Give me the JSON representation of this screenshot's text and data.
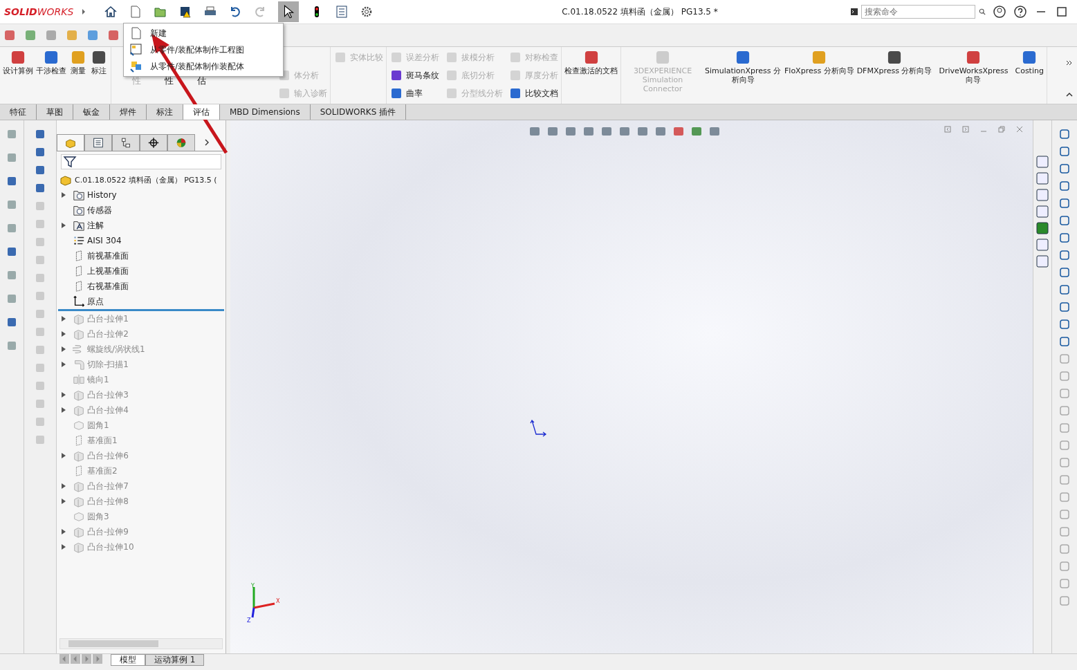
{
  "titlebar": {
    "logo": "**SOLID**WORKS",
    "title": "C.01.18.0522 填料函（金属） PG13.5 *",
    "search": {
      "placeholder": "搜索命令"
    }
  },
  "new_menu": {
    "items": [
      {
        "label": "新建",
        "kind": "new"
      },
      {
        "label": "从零件/装配体制作工程图",
        "kind": "drawing"
      },
      {
        "label": "从零件/装配体制作装配体",
        "kind": "assembly"
      }
    ]
  },
  "ribbon": {
    "groups": [
      {
        "kind": "large",
        "items": [
          {
            "label": "设计算例",
            "disabled": false
          },
          {
            "label": "干涉检查",
            "disabled": false
          },
          {
            "label": "测量",
            "disabled": false
          },
          {
            "label": "标注",
            "disabled": false
          }
        ]
      },
      {
        "kind": "fragment",
        "items": [
          {
            "label": "性",
            "disabled": true
          },
          {
            "label": "性",
            "disabled": false
          },
          {
            "label": "估",
            "disabled": false
          }
        ]
      },
      {
        "kind": "small",
        "items": [
          {
            "label": "体分析",
            "disabled": true
          },
          {
            "label": "输入诊断",
            "disabled": true
          }
        ]
      },
      {
        "kind": "small",
        "items": [
          {
            "label": "实体比较",
            "disabled": true
          }
        ]
      },
      {
        "kind": "small",
        "items": [
          {
            "label": "误差分析",
            "disabled": true
          },
          {
            "label": "斑马条纹",
            "disabled": false
          },
          {
            "label": "曲率",
            "disabled": false
          },
          {
            "label": "拔模分析",
            "disabled": true
          },
          {
            "label": "底切分析",
            "disabled": true
          },
          {
            "label": "分型线分析",
            "disabled": true
          },
          {
            "label": "对称检查",
            "disabled": true
          },
          {
            "label": "厚度分析",
            "disabled": true
          },
          {
            "label": "比较文档",
            "disabled": false
          }
        ]
      },
      {
        "kind": "large",
        "items": [
          {
            "label": "检查激活的文档",
            "disabled": false
          }
        ]
      },
      {
        "kind": "large",
        "items": [
          {
            "label": "3DEXPERIENCE Simulation Connector",
            "disabled": true
          },
          {
            "label": "SimulationXpress 分析向导",
            "disabled": false
          },
          {
            "label": "FloXpress 分析向导",
            "disabled": false
          },
          {
            "label": "DFMXpress 分析向导",
            "disabled": false
          },
          {
            "label": "DriveWorksXpress 向导",
            "disabled": false
          },
          {
            "label": "Costing",
            "disabled": false
          }
        ]
      }
    ]
  },
  "command_tabs": [
    {
      "label": "特征",
      "selected": false
    },
    {
      "label": "草图",
      "selected": false
    },
    {
      "label": "钣金",
      "selected": false
    },
    {
      "label": "焊件",
      "selected": false
    },
    {
      "label": "标注",
      "selected": false
    },
    {
      "label": "评估",
      "selected": true
    },
    {
      "label": "MBD Dimensions",
      "selected": false
    },
    {
      "label": "SOLIDWORKS 插件",
      "selected": false
    }
  ],
  "tree": {
    "root": "C.01.18.0522 填料函（金属） PG13.5 (",
    "items": [
      {
        "label": "History",
        "kind": "history",
        "expandable": true,
        "dimmed": false
      },
      {
        "label": "传感器",
        "kind": "sensor",
        "expandable": false,
        "dimmed": false
      },
      {
        "label": "注解",
        "kind": "annotation",
        "expandable": true,
        "dimmed": false
      },
      {
        "label": "AISI 304",
        "kind": "material",
        "expandable": false,
        "dimmed": false
      },
      {
        "label": "前视基准面",
        "kind": "plane",
        "expandable": false,
        "dimmed": false
      },
      {
        "label": "上视基准面",
        "kind": "plane",
        "expandable": false,
        "dimmed": false
      },
      {
        "label": "右视基准面",
        "kind": "plane",
        "expandable": false,
        "dimmed": false
      },
      {
        "label": "原点",
        "kind": "origin",
        "expandable": false,
        "dimmed": false
      },
      {
        "kind": "rollback"
      },
      {
        "label": "凸台-拉伸1",
        "kind": "extrude",
        "expandable": true,
        "dimmed": true
      },
      {
        "label": "凸台-拉伸2",
        "kind": "extrude",
        "expandable": true,
        "dimmed": true
      },
      {
        "label": "螺旋线/涡状线1",
        "kind": "helix",
        "expandable": true,
        "dimmed": true
      },
      {
        "label": "切除-扫描1",
        "kind": "sweep",
        "expandable": true,
        "dimmed": true
      },
      {
        "label": "镜向1",
        "kind": "mirror",
        "expandable": false,
        "dimmed": true
      },
      {
        "label": "凸台-拉伸3",
        "kind": "extrude",
        "expandable": true,
        "dimmed": true
      },
      {
        "label": "凸台-拉伸4",
        "kind": "extrude",
        "expandable": true,
        "dimmed": true
      },
      {
        "label": "圆角1",
        "kind": "fillet",
        "expandable": false,
        "dimmed": true
      },
      {
        "label": "基准面1",
        "kind": "plane",
        "expandable": false,
        "dimmed": true
      },
      {
        "label": "凸台-拉伸6",
        "kind": "extrude",
        "expandable": true,
        "dimmed": true
      },
      {
        "label": "基准面2",
        "kind": "plane",
        "expandable": false,
        "dimmed": true
      },
      {
        "label": "凸台-拉伸7",
        "kind": "extrude",
        "expandable": true,
        "dimmed": true
      },
      {
        "label": "凸台-拉伸8",
        "kind": "extrude",
        "expandable": true,
        "dimmed": true
      },
      {
        "label": "圆角3",
        "kind": "fillet",
        "expandable": false,
        "dimmed": true
      },
      {
        "label": "凸台-拉伸9",
        "kind": "extrude",
        "expandable": true,
        "dimmed": true
      },
      {
        "label": "凸台-拉伸10",
        "kind": "extrude",
        "expandable": true,
        "dimmed": true
      }
    ]
  },
  "triad": {
    "x": "X",
    "y": "Y",
    "z": "Z"
  },
  "bottom_tabs": [
    {
      "label": "模型",
      "selected": true
    },
    {
      "label": "运动算例 1",
      "selected": false
    }
  ]
}
